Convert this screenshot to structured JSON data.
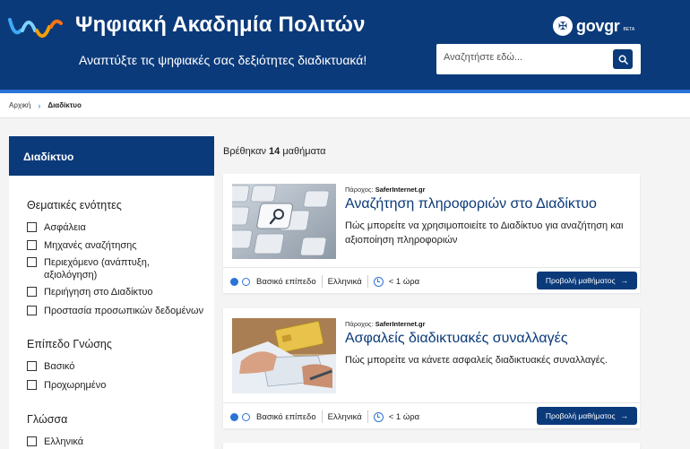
{
  "header": {
    "title": "Ψηφιακή Ακαδημία Πολιτών",
    "subtitle": "Αναπτύξτε τις ψηφιακές σας δεξιότητες διαδικτυακά!",
    "govgr": "govgr",
    "govgr_beta": "BETA",
    "search_placeholder": "Αναζητήστε εδώ...",
    "brand_color": "#0b3a7a",
    "accent_color": "#2b73d6"
  },
  "breadcrumb": {
    "home": "Αρχική",
    "current": "Διαδίκτυο"
  },
  "sidebar": {
    "heading": "Διαδίκτυο",
    "groups": [
      {
        "title": "Θεματικές ενότητες",
        "items": [
          "Ασφάλεια",
          "Μηχανές αναζήτησης",
          "Περιεχόμενο (ανάπτυξη, αξιολόγηση)",
          "Περιήγηση στο Διαδίκτυο",
          "Προστασία προσωπικών δεδομένων"
        ]
      },
      {
        "title": "Επίπεδο Γνώσης",
        "items": [
          "Βασικό",
          "Προχωρημένο"
        ]
      },
      {
        "title": "Γλώσσα",
        "items": [
          "Ελληνικά"
        ]
      }
    ]
  },
  "results": {
    "prefix": "Βρέθηκαν",
    "count": "14",
    "suffix": "μαθήματα"
  },
  "courses": [
    {
      "provider_label": "Πάροχος:",
      "provider": "SaferInternet.gr",
      "title": "Αναζήτηση πληροφοριών στο Διαδίκτυο",
      "description": "Πώς μπορείτε να χρησιμοποιείτε το Διαδίκτυο για αναζήτηση και αξιοποίηση πληροφοριών",
      "level": "Βασικό επίπεδο",
      "language": "Ελληνικά",
      "duration": "< 1 ώρα",
      "button": "Προβολή μαθήματος"
    },
    {
      "provider_label": "Πάροχος:",
      "provider": "SaferInternet.gr",
      "title": "Ασφαλείς διαδικτυακές συναλλαγές",
      "description": "Πώς μπορείτε να κάνετε ασφαλείς διαδικτυακές συναλλαγές.",
      "level": "Βασικό επίπεδο",
      "language": "Ελληνικά",
      "duration": "< 1 ώρα",
      "button": "Προβολή μαθήματος"
    }
  ]
}
